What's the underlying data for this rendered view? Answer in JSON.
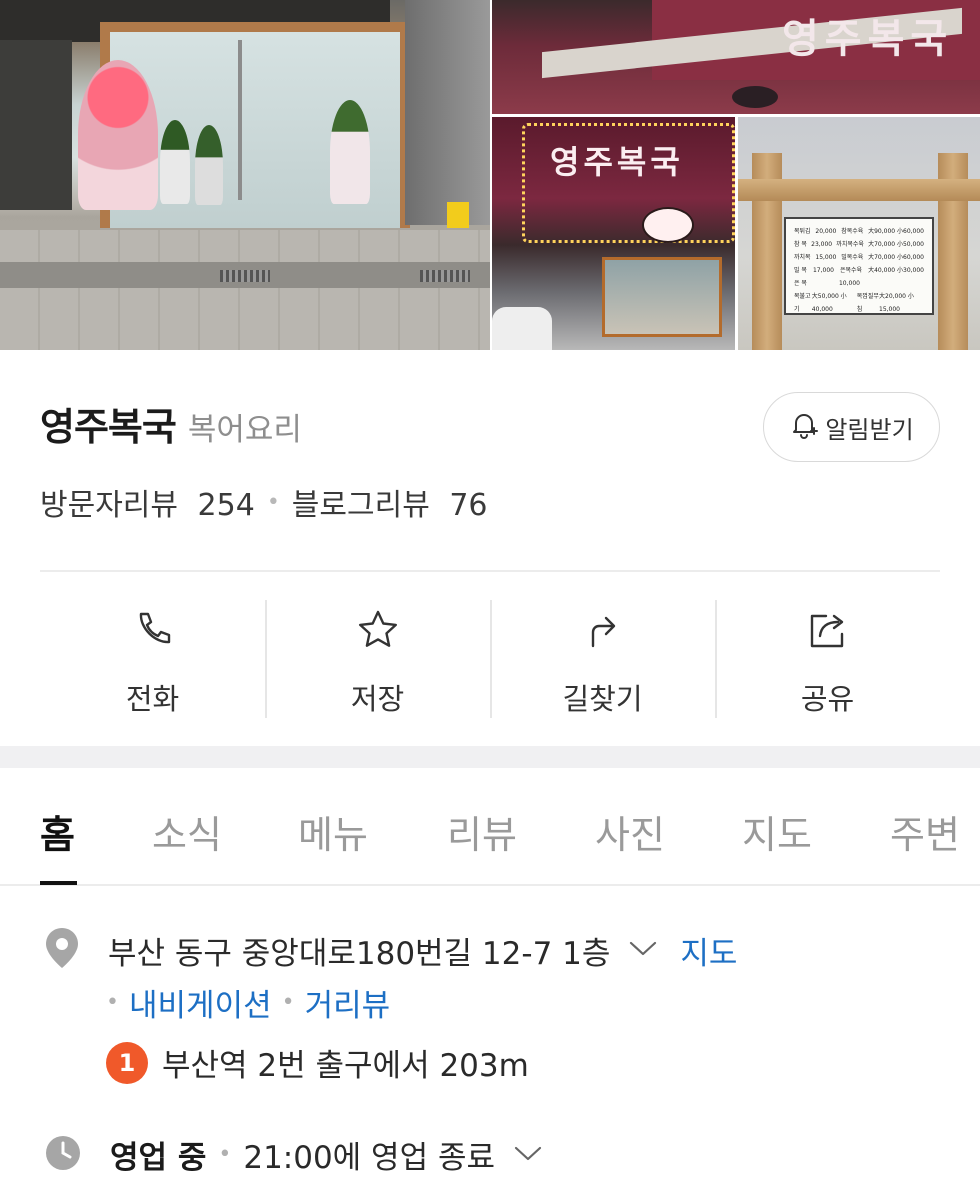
{
  "place": {
    "name": "영주복국",
    "category": "복어요리",
    "alert_label": "알림받기",
    "visitor_review_label": "방문자리뷰",
    "visitor_review_count": "254",
    "blog_review_label": "블로그리뷰",
    "blog_review_count": "76"
  },
  "actions": [
    {
      "label": "전화",
      "icon": "phone-icon"
    },
    {
      "label": "저장",
      "icon": "star-icon"
    },
    {
      "label": "길찾기",
      "icon": "directions-icon"
    },
    {
      "label": "공유",
      "icon": "share-icon"
    }
  ],
  "tabs": [
    "홈",
    "소식",
    "메뉴",
    "리뷰",
    "사진",
    "지도",
    "주변"
  ],
  "active_tab": "홈",
  "info": {
    "address": "부산 동구 중앙대로180번길 12-7 1층",
    "map_link": "지도",
    "navigation_link": "내비게이션",
    "street_view_link": "거리뷰",
    "station_number": "1",
    "station_text": "부산역 2번 출구에서 203m",
    "hours_status": "영업 중",
    "hours_text": "21:00에 영업 종료"
  },
  "photos": {
    "storefront_sign": "영주복국",
    "menu_board": [
      [
        "복튀김",
        "20,000",
        "참복수육",
        "大90,000 小60,000"
      ],
      [
        "참 복",
        "23,000",
        "까치복수육",
        "大70,000 小50,000"
      ],
      [
        "까치복",
        "15,000",
        "밀복수육",
        "大70,000 小60,000"
      ],
      [
        "밀 복",
        "17,000",
        "은복수육",
        "大40,000 小30,000"
      ],
      [
        "은 복",
        "10,000",
        "",
        ""
      ],
      [
        "복불고기",
        "大50,000 小40,000",
        "복껍질무침",
        "大20,000 小15,000"
      ]
    ]
  },
  "colors": {
    "accent_link": "#1d6fc4",
    "station_badge": "#f0592a",
    "text_primary": "#1b1b1b",
    "text_muted": "#8e8e8e"
  }
}
